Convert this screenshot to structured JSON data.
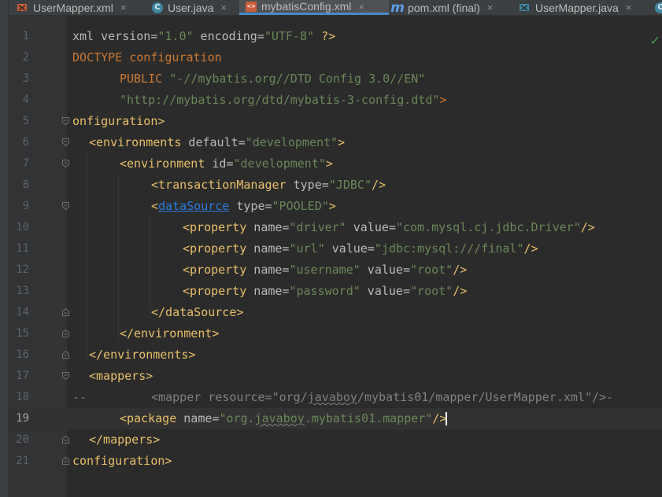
{
  "tabs": [
    {
      "label": "UserMapper.xml",
      "icon": "mapper-xml-icon",
      "active": false
    },
    {
      "label": "User.java",
      "icon": "java-class-icon",
      "active": false
    },
    {
      "label": "mybatisConfig.xml",
      "icon": "xml-file-icon",
      "active": true
    },
    {
      "label": "pom.xml (final)",
      "icon": "maven-icon",
      "active": false
    },
    {
      "label": "UserMapper.java",
      "icon": "mapper-java-icon",
      "active": false
    }
  ],
  "tab_close_glyph": "×",
  "editor": {
    "current_line": 19,
    "status_icon": "check-icon",
    "status_glyph": "✓",
    "line_numbers": [
      "1",
      "2",
      "3",
      "4",
      "5",
      "6",
      "7",
      "8",
      "9",
      "10",
      "11",
      "12",
      "13",
      "14",
      "15",
      "16",
      "17",
      "18",
      "19",
      "20",
      "21"
    ],
    "lines": {
      "l1": {
        "a": "xml version=",
        "b": "\"1.0\"",
        "c": " encoding=",
        "d": "\"UTF-8\"",
        "e": " ?>"
      },
      "l2": {
        "a": "DOCTYPE configuration"
      },
      "l3": {
        "a": "PUBLIC ",
        "b": "\"-//mybatis.org//DTD Config 3.0//EN\""
      },
      "l4": {
        "a": "\"http://mybatis.org/dtd/mybatis-3-config.dtd\"",
        "b": ">"
      },
      "l5": {
        "a": "onfiguration>"
      },
      "l6": {
        "a": "<environments",
        "b": " default=",
        "c": "\"development\"",
        "d": ">"
      },
      "l7": {
        "a": "<environment",
        "b": " id=",
        "c": "\"development\"",
        "d": ">"
      },
      "l8": {
        "a": "<transactionManager",
        "b": " type=",
        "c": "\"JDBC\"",
        "d": "/>"
      },
      "l9": {
        "a": "<",
        "b": "dataSource",
        "c": " type=",
        "d": "\"POOLED\"",
        "e": ">"
      },
      "l10": {
        "a": "<property",
        "b": " name=",
        "c": "\"driver\"",
        "d": " value=",
        "e": "\"com.mysql.cj.jdbc.Driver\"",
        "f": "/>"
      },
      "l11": {
        "a": "<property",
        "b": " name=",
        "c": "\"url\"",
        "d": " value=",
        "e": "\"jdbc:mysql:///final\"",
        "f": "/>"
      },
      "l12": {
        "a": "<property",
        "b": " name=",
        "c": "\"username\"",
        "d": " value=",
        "e": "\"root\"",
        "f": "/>"
      },
      "l13": {
        "a": "<property",
        "b": " name=",
        "c": "\"password\"",
        "d": " value=",
        "e": "\"root\"",
        "f": "/>"
      },
      "l14": {
        "a": "</dataSource>"
      },
      "l15": {
        "a": "</environment>"
      },
      "l16": {
        "a": "</environments>"
      },
      "l17": {
        "a": "<mappers>"
      },
      "l18": {
        "a": "--",
        "b": "<mapper resource=\"org/",
        "c": "javaboy",
        "d": "/mybatis01/mapper/UserMapper.xml\"/>-"
      },
      "l19": {
        "a": "<package",
        "b": " name=",
        "c": "\"org.",
        "d": "javaboy",
        "e": ".mybatis01.mapper\"",
        "f": "/>"
      },
      "l20": {
        "a": "</mappers>"
      },
      "l21": {
        "a": "configuration>"
      }
    }
  },
  "colors": {
    "background": "#2b2b2b",
    "gutter": "#313335",
    "tag": "#e8bf6a",
    "attribute": "#bababa",
    "string": "#6a8759",
    "keyword": "#cc7832",
    "link": "#287bde",
    "comment": "#808080",
    "active_tab_underline": "#4a88c7"
  }
}
